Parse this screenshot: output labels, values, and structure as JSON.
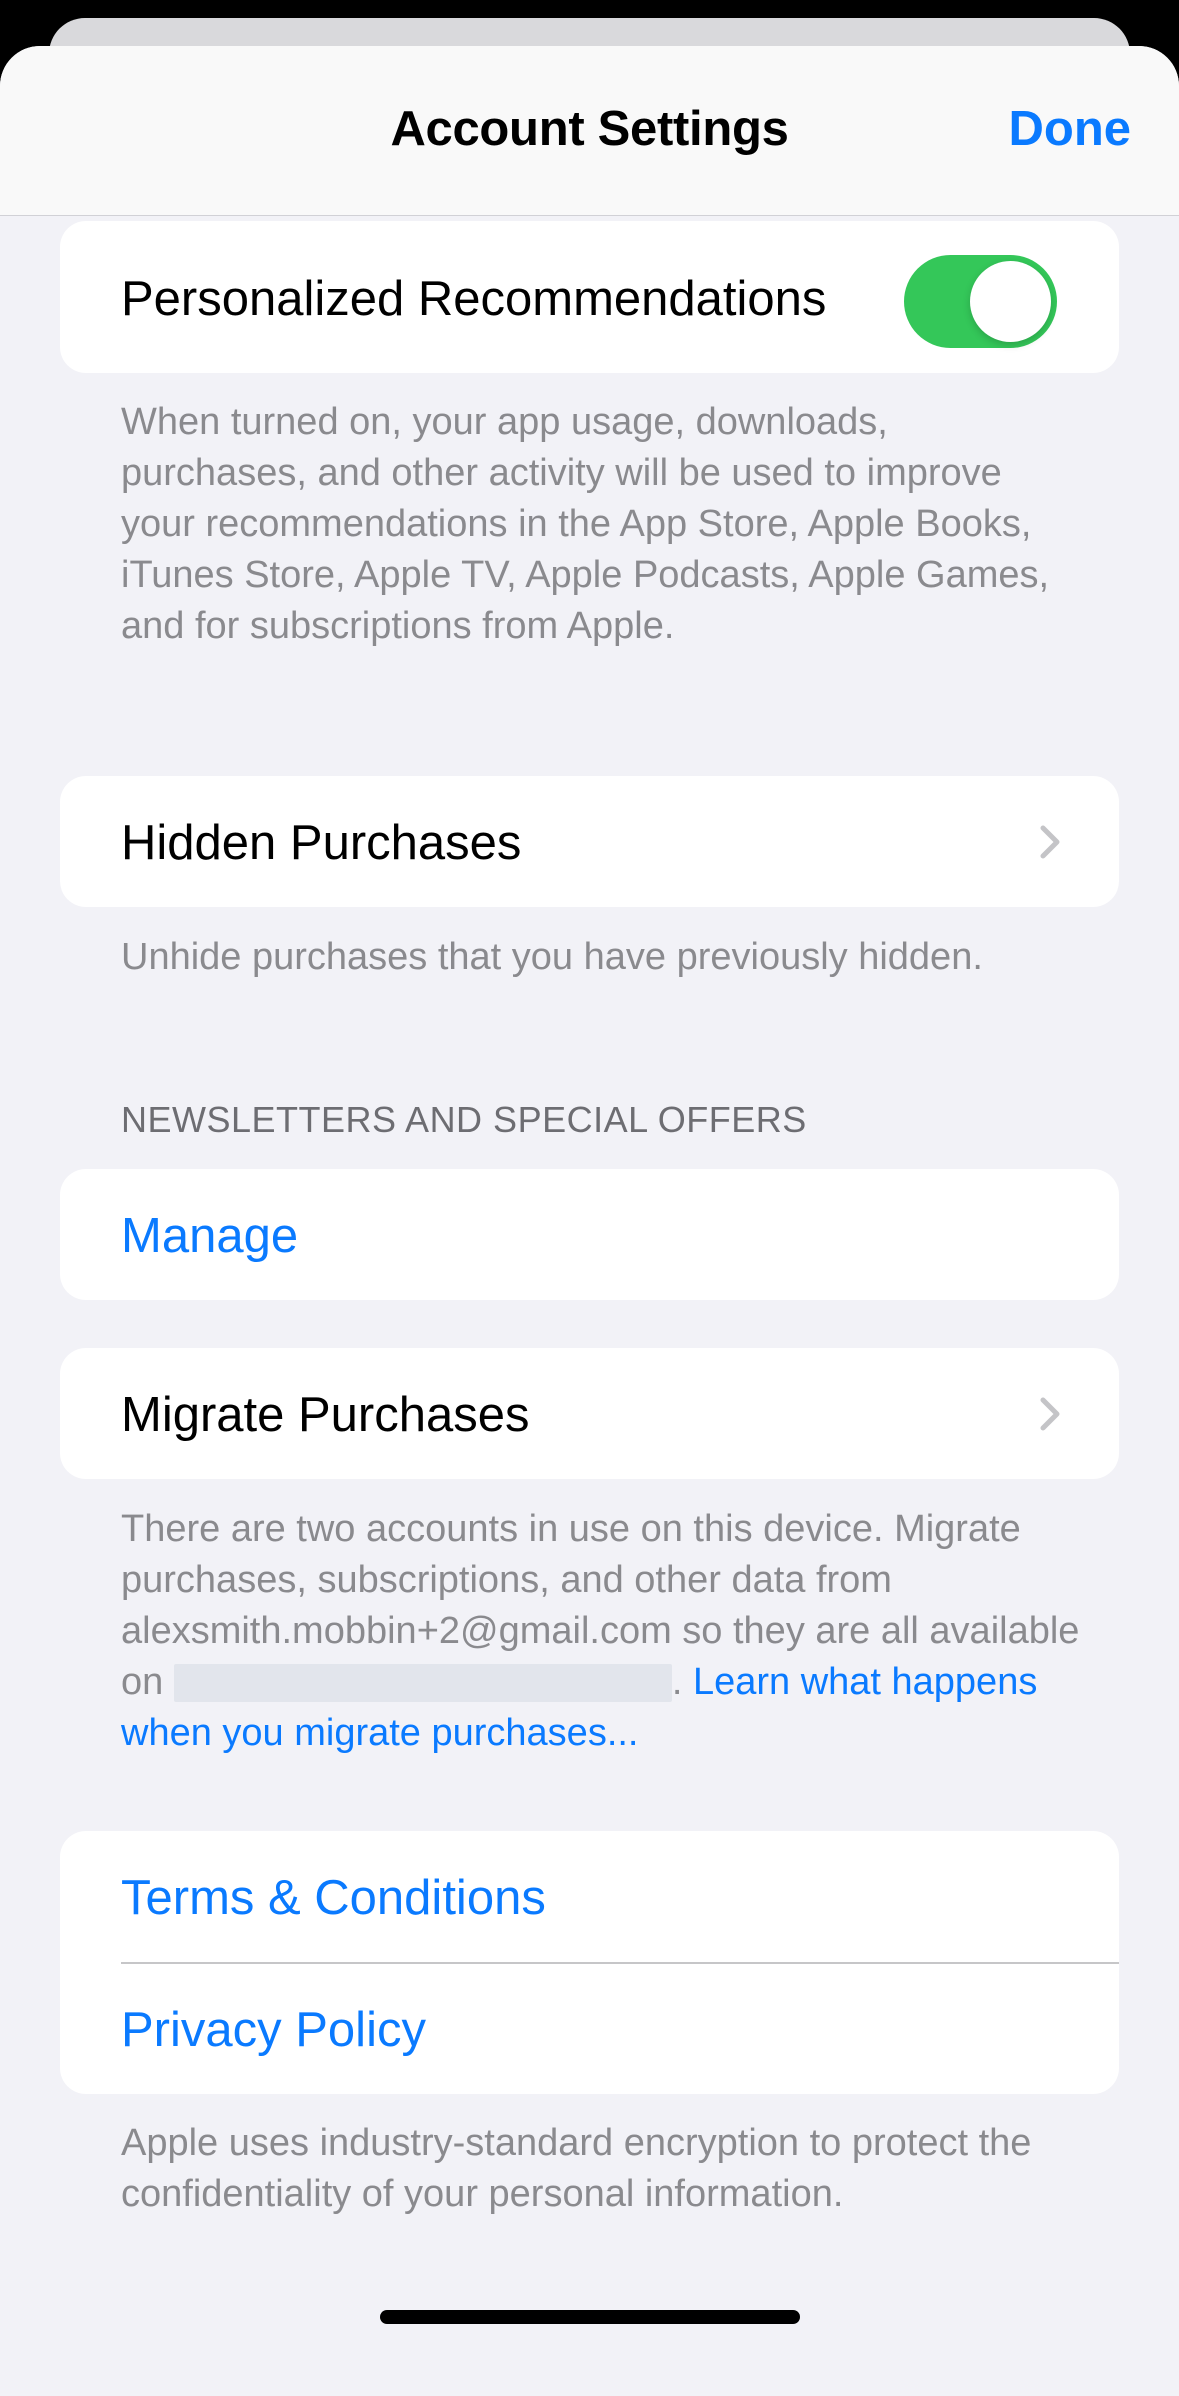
{
  "nav": {
    "title": "Account Settings",
    "done_label": "Done"
  },
  "personalized": {
    "label": "Personalized Recommendations",
    "toggle_on": true,
    "footer": "When turned on, your app usage, downloads, purchases, and other activity will be used to improve your recommendations in the App Store, Apple Books, iTunes Store, Apple TV, Apple Podcasts, Apple Games, and for subscriptions from Apple."
  },
  "hidden_purchases": {
    "label": "Hidden Purchases",
    "footer": "Unhide purchases that you have previously hidden."
  },
  "newsletters": {
    "header": "NEWSLETTERS AND SPECIAL OFFERS",
    "manage_label": "Manage"
  },
  "migrate": {
    "label": "Migrate Purchases",
    "footer_prefix": "There are two accounts in use on this device. Migrate purchases, subscriptions, and other data from alexsmith.mobbin+2@gmail.com so they are all available on ",
    "footer_suffix": ". ",
    "link_text": "Learn what happens when you migrate purchases..."
  },
  "legal": {
    "terms_label": "Terms & Conditions",
    "privacy_label": "Privacy Policy",
    "footer": "Apple uses industry-standard encryption to protect the confidentiality of your personal information."
  },
  "colors": {
    "accent": "#0a7aff",
    "toggle_on": "#34c759",
    "background": "#f2f2f7"
  }
}
